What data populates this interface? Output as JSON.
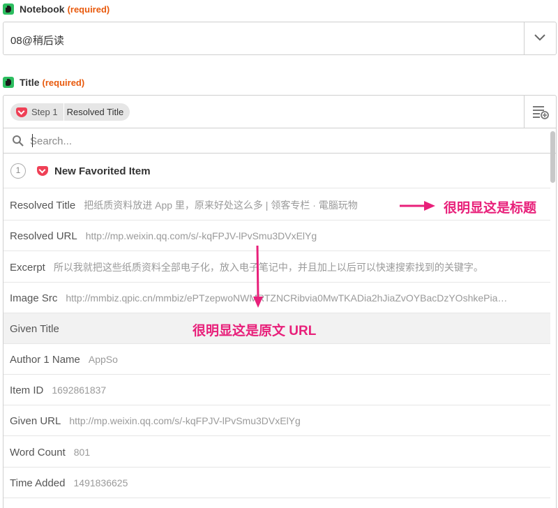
{
  "notebook": {
    "label": "Notebook",
    "required": "(required)",
    "value": "08@稍后读"
  },
  "title_field": {
    "label": "Title",
    "required": "(required)",
    "pill_step": "Step 1",
    "pill_field": "Resolved Title"
  },
  "search": {
    "placeholder": "Search..."
  },
  "group": {
    "number": "1",
    "title": "New Favorited Item"
  },
  "options": [
    {
      "key": "Resolved Title",
      "value": "把纸质资料放进 App 里，原来好处这么多 | 领客专栏 · 電腦玩物"
    },
    {
      "key": "Resolved URL",
      "value": "http://mp.weixin.qq.com/s/-kqFPJV-lPvSmu3DVxElYg"
    },
    {
      "key": "Excerpt",
      "value": "所以我就把这些纸质资料全部电子化，放入电子笔记中，并且加上以后可以快速搜索找到的关键字。"
    },
    {
      "key": "Image Src",
      "value": "http://mmbiz.qpic.cn/mmbiz/ePTzepwoNWMRTZNCRibvia0MwTKADia2hJiaZvOYBacDzYOshkePia…"
    },
    {
      "key": "Given Title",
      "value": ""
    },
    {
      "key": "Author 1 Name",
      "value": "AppSo"
    },
    {
      "key": "Item ID",
      "value": "1692861837"
    },
    {
      "key": "Given URL",
      "value": "http://mp.weixin.qq.com/s/-kqFPJV-lPvSmu3DVxElYg"
    },
    {
      "key": "Word Count",
      "value": "801"
    },
    {
      "key": "Time Added",
      "value": "1491836625"
    }
  ],
  "annotations": {
    "title_note": "很明显这是标题",
    "url_note": "很明显这是原文 URL",
    "color": "#e8207a"
  },
  "icons": {
    "app": "evernote-icon",
    "step": "pocket-icon",
    "search": "search-icon",
    "dropdown": "chevron-down-icon",
    "insert": "insert-field-icon"
  }
}
